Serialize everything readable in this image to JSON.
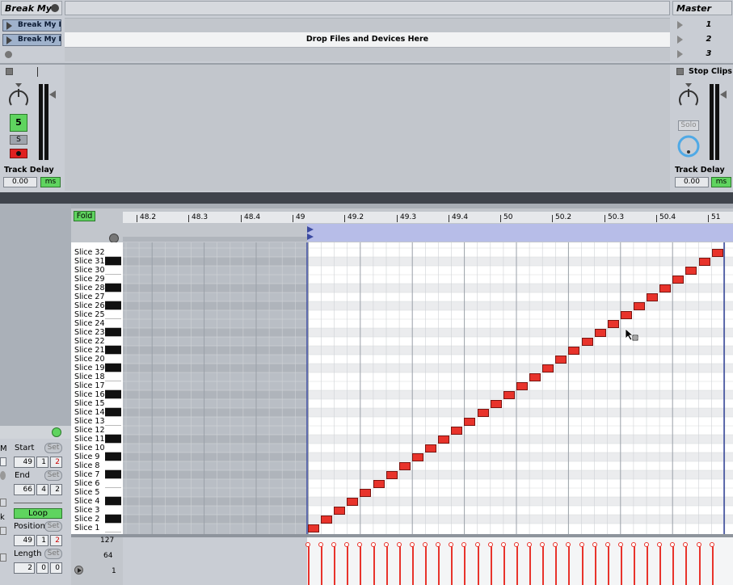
{
  "session": {
    "track_title": "Break My",
    "clip_names": [
      "Break My Fa",
      "Break My Fa"
    ],
    "drop_text": "Drop Files and Devices Here",
    "master_title": "Master",
    "scenes": [
      "1",
      "2",
      "3"
    ],
    "stop_clips": "Stop Clips",
    "track_number": "5",
    "solo_left": "S",
    "solo_master": "Solo",
    "track_delay_label": "Track Delay",
    "track_delay_value": "0.00",
    "ms_label": "ms"
  },
  "clip_panel": {
    "m_label": "M",
    "k_label": "k",
    "start_label": "Start",
    "end_label": "End",
    "loop_label": "Loop",
    "position_label": "Position",
    "length_label": "Length",
    "set_label": "Set",
    "start": [
      "49",
      "1",
      "2"
    ],
    "end": [
      "66",
      "4",
      "2"
    ],
    "position": [
      "49",
      "1",
      "2"
    ],
    "length": [
      "2",
      "0",
      "0"
    ]
  },
  "editor": {
    "fold_label": "Fold",
    "ruler": [
      "48.2",
      "48.3",
      "48.4",
      "49",
      "49.2",
      "49.3",
      "49.4",
      "50",
      "50.2",
      "50.3",
      "50.4",
      "51"
    ],
    "slices": [
      "Slice 32",
      "Slice 31",
      "Slice 30",
      "Slice 29",
      "Slice 28",
      "Slice 27",
      "Slice 26",
      "Slice 25",
      "Slice 24",
      "Slice 23",
      "Slice 22",
      "Slice 21",
      "Slice 20",
      "Slice 19",
      "Slice 18",
      "Slice 17",
      "Slice 16",
      "Slice 15",
      "Slice 14",
      "Slice 13",
      "Slice 12",
      "Slice 11",
      "Slice 10",
      "Slice 9",
      "Slice 8",
      "Slice 7",
      "Slice 6",
      "Slice 5",
      "Slice 4",
      "Slice 3",
      "Slice 2",
      "Slice 1"
    ],
    "velocity_labels": [
      "127",
      "64",
      "1"
    ],
    "note_count": 32
  },
  "colors": {
    "note": "#e8332b",
    "green": "#5fd45f",
    "red_button": "#e02020"
  }
}
